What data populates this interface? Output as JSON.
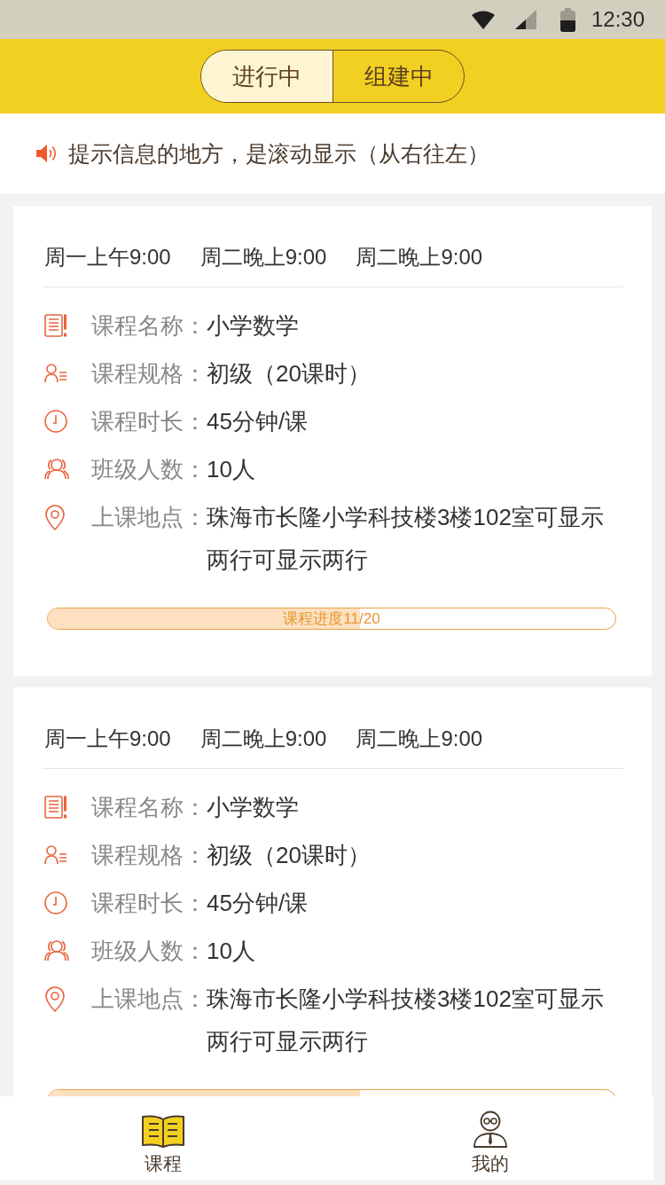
{
  "status_bar": {
    "time": "12:30"
  },
  "tabs": [
    {
      "label": "进行中",
      "selected": true
    },
    {
      "label": "组建中",
      "selected": false
    }
  ],
  "notice": {
    "text": "提示信息的地方，是滚动显示（从右往左）"
  },
  "courses": [
    {
      "schedule": [
        "周一上午9:00",
        "周二晚上9:00",
        "周二晚上9:00"
      ],
      "details": [
        {
          "kind": "name",
          "label": "课程名称：",
          "value": "小学数学"
        },
        {
          "kind": "spec",
          "label": "课程规格：",
          "value": "初级（20课时）"
        },
        {
          "kind": "duration",
          "label": "课程时长：",
          "value": "45分钟/课"
        },
        {
          "kind": "size",
          "label": "班级人数：",
          "value": "10人"
        },
        {
          "kind": "location",
          "label": "上课地点：",
          "value": "珠海市长隆小学科技楼3楼102室可显示两行可显示两行"
        }
      ],
      "progress": {
        "label": "课程进度11/20",
        "level": 0.55
      }
    },
    {
      "schedule": [
        "周一上午9:00",
        "周二晚上9:00",
        "周二晚上9:00"
      ],
      "details": [
        {
          "kind": "name",
          "label": "课程名称：",
          "value": "小学数学"
        },
        {
          "kind": "spec",
          "label": "课程规格：",
          "value": "初级（20课时）"
        },
        {
          "kind": "duration",
          "label": "课程时长：",
          "value": "45分钟/课"
        },
        {
          "kind": "size",
          "label": "班级人数：",
          "value": "10人"
        },
        {
          "kind": "location",
          "label": "上课地点：",
          "value": "珠海市长隆小学科技楼3楼102室可显示两行可显示两行"
        }
      ],
      "progress": {
        "level": 0.55
      }
    }
  ],
  "bottom_nav": [
    {
      "kind": "courses",
      "label": "课程",
      "selected": true
    },
    {
      "kind": "profile",
      "label": "我的",
      "selected": false
    }
  ]
}
